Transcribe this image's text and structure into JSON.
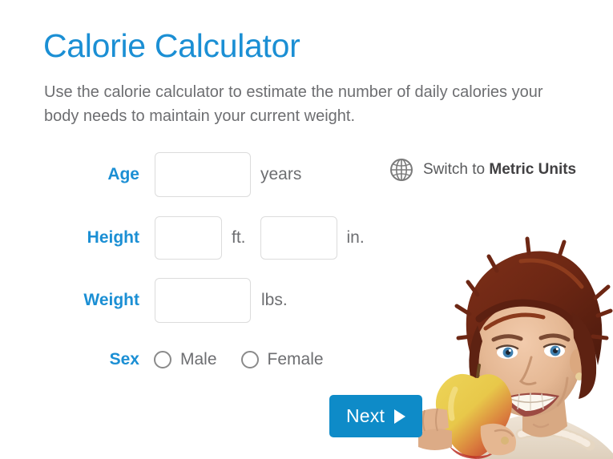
{
  "header": {
    "title": "Calorie Calculator",
    "subtitle": "Use the calorie calculator to estimate the number of daily calories your body needs to maintain your current weight."
  },
  "units_switch": {
    "icon": "globe-icon",
    "prefix": "Switch to ",
    "target_units": "Metric Units"
  },
  "form": {
    "age": {
      "label": "Age",
      "value": "",
      "placeholder": "",
      "unit": "years"
    },
    "height": {
      "label": "Height",
      "feet": {
        "value": "",
        "placeholder": "",
        "unit": "ft."
      },
      "inches": {
        "value": "",
        "placeholder": "",
        "unit": "in."
      }
    },
    "weight": {
      "label": "Weight",
      "value": "",
      "placeholder": "",
      "unit": "lbs."
    },
    "sex": {
      "label": "Sex",
      "options": [
        {
          "label": "Male",
          "selected": false
        },
        {
          "label": "Female",
          "selected": false
        }
      ]
    }
  },
  "actions": {
    "next_label": "Next",
    "next_icon": "arrow-right-icon"
  },
  "photo": {
    "description": "Smiling woman with short auburn hair holding an apple"
  },
  "colors": {
    "accent_blue": "#1b8fd4",
    "button_blue": "#0e8bc8",
    "body_gray": "#6d6e71",
    "input_border": "#dcdcdc"
  }
}
